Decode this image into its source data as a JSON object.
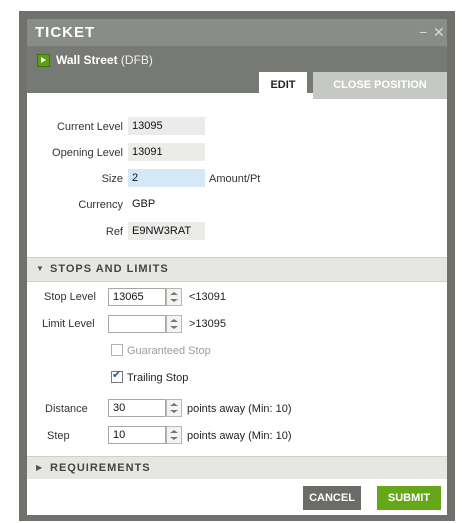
{
  "window": {
    "title": "TICKET",
    "minimize_glyph": "−",
    "close_glyph": "✕"
  },
  "instrument": {
    "name": "Wall Street",
    "code": "(DFB)",
    "icon": "play-icon",
    "icon_color": "#5aa012"
  },
  "tabs": [
    {
      "label": "EDIT",
      "active": true
    },
    {
      "label": "CLOSE POSITION",
      "active": false
    }
  ],
  "details": {
    "current_level_label": "Current Level",
    "current_level": "13095",
    "opening_level_label": "Opening Level",
    "opening_level": "13091",
    "size_label": "Size",
    "size": "2",
    "size_unit": "Amount/Pt",
    "currency_label": "Currency",
    "currency": "GBP",
    "ref_label": "Ref",
    "ref": "E9NW3RAT"
  },
  "stops": {
    "header": "STOPS AND LIMITS",
    "stop_level_label": "Stop Level",
    "stop_level": "13065",
    "stop_hint": "<13091",
    "limit_level_label": "Limit Level",
    "limit_level": "",
    "limit_hint": ">13095",
    "guaranteed_stop_label": "Guaranteed Stop",
    "guaranteed_stop_checked": false,
    "guaranteed_stop_enabled": false,
    "trailing_stop_label": "Trailing Stop",
    "trailing_stop_checked": true,
    "distance_label": "Distance",
    "distance": "30",
    "distance_hint": "points away (Min: 10)",
    "step_label": "Step",
    "step": "10",
    "step_hint": "points away (Min: 10)"
  },
  "requirements": {
    "header": "REQUIREMENTS"
  },
  "buttons": {
    "cancel": "CANCEL",
    "submit": "SUBMIT"
  },
  "colors": {
    "accent_green": "#64a81a",
    "titlebar": "#8a8c88",
    "input_highlight": "#d5e8f8"
  }
}
